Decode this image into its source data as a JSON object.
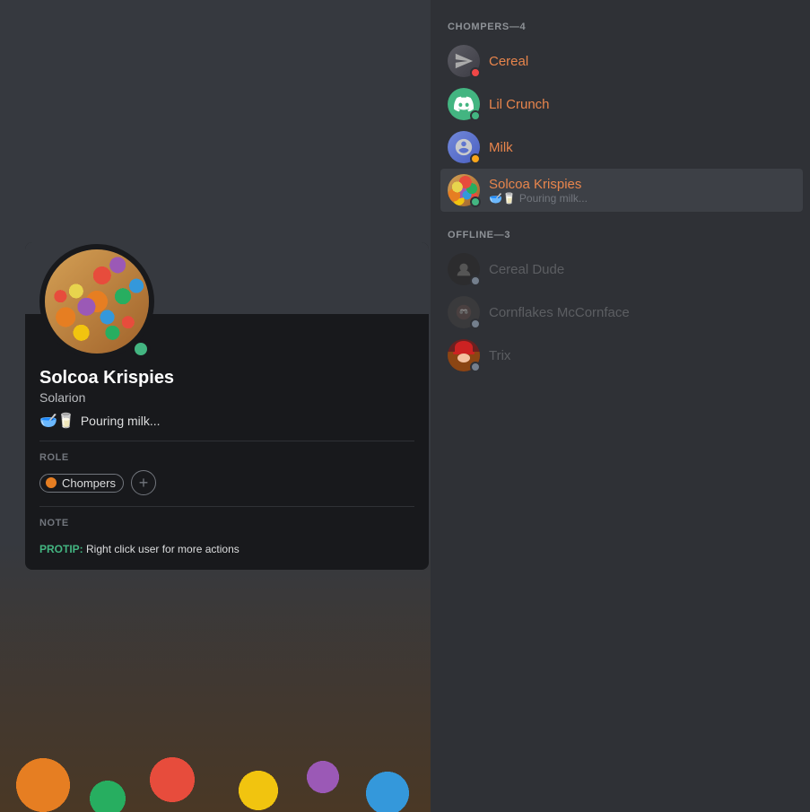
{
  "left_bg": {
    "visible": true
  },
  "profile_card": {
    "username": "Solcoa Krispies",
    "server_name": "Solarion",
    "status_emojis": "🥣🥛",
    "status_text": "Pouring milk...",
    "role_section_label": "ROLE",
    "role_name": "Chompers",
    "note_section_label": "NOTE",
    "protip_label": "PROTIP:",
    "protip_text": "Right click user for more actions",
    "add_role_label": "+"
  },
  "right_panel": {
    "chompers_header": "CHOMPERS—4",
    "offline_header": "OFFLINE—3",
    "members_online": [
      {
        "name": "Cereal",
        "status": "dnd",
        "avatar_type": "gray_face"
      },
      {
        "name": "Lil Crunch",
        "status": "online",
        "avatar_type": "discord_green"
      },
      {
        "name": "Milk",
        "status": "idle",
        "avatar_type": "space_wolf"
      },
      {
        "name": "Solcoa Krispies",
        "status": "online",
        "avatar_type": "cereal_bowl",
        "subtext_emojis": "🥣🥛",
        "subtext": "Pouring milk..."
      }
    ],
    "members_offline": [
      {
        "name": "Cereal Dude",
        "status": "offline",
        "avatar_type": "dark_face"
      },
      {
        "name": "Cornflakes McCornface",
        "status": "offline",
        "avatar_type": "dragon_face"
      },
      {
        "name": "Trix",
        "status": "offline",
        "avatar_type": "red_hat"
      }
    ]
  }
}
